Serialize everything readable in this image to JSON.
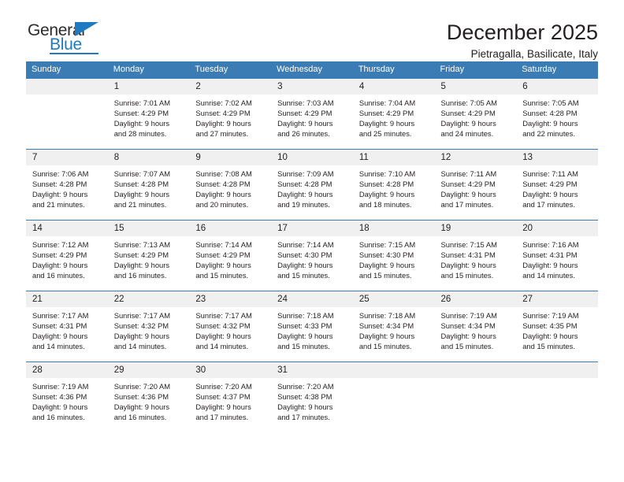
{
  "brand": {
    "name_top": "General",
    "name_bottom": "Blue",
    "accent_color": "#1f7ac0",
    "triangle_icon": "triangle-icon"
  },
  "header": {
    "title": "December 2025",
    "subtitle": "Pietragalla, Basilicate, Italy"
  },
  "theme": {
    "header_row_bg": "#3b7cb5",
    "daynum_bg": "#f0f0f0",
    "text_color": "#231f20"
  },
  "weekday_headers": [
    "Sunday",
    "Monday",
    "Tuesday",
    "Wednesday",
    "Thursday",
    "Friday",
    "Saturday"
  ],
  "labels": {
    "sunrise_prefix": "Sunrise:",
    "sunset_prefix": "Sunset:",
    "daylight_prefix": "Daylight:"
  },
  "weeks": [
    [
      {
        "day": "",
        "lines": []
      },
      {
        "day": "1",
        "lines": [
          "Sunrise: 7:01 AM",
          "Sunset: 4:29 PM",
          "Daylight: 9 hours",
          "and 28 minutes."
        ]
      },
      {
        "day": "2",
        "lines": [
          "Sunrise: 7:02 AM",
          "Sunset: 4:29 PM",
          "Daylight: 9 hours",
          "and 27 minutes."
        ]
      },
      {
        "day": "3",
        "lines": [
          "Sunrise: 7:03 AM",
          "Sunset: 4:29 PM",
          "Daylight: 9 hours",
          "and 26 minutes."
        ]
      },
      {
        "day": "4",
        "lines": [
          "Sunrise: 7:04 AM",
          "Sunset: 4:29 PM",
          "Daylight: 9 hours",
          "and 25 minutes."
        ]
      },
      {
        "day": "5",
        "lines": [
          "Sunrise: 7:05 AM",
          "Sunset: 4:29 PM",
          "Daylight: 9 hours",
          "and 24 minutes."
        ]
      },
      {
        "day": "6",
        "lines": [
          "Sunrise: 7:05 AM",
          "Sunset: 4:28 PM",
          "Daylight: 9 hours",
          "and 22 minutes."
        ]
      }
    ],
    [
      {
        "day": "7",
        "lines": [
          "Sunrise: 7:06 AM",
          "Sunset: 4:28 PM",
          "Daylight: 9 hours",
          "and 21 minutes."
        ]
      },
      {
        "day": "8",
        "lines": [
          "Sunrise: 7:07 AM",
          "Sunset: 4:28 PM",
          "Daylight: 9 hours",
          "and 21 minutes."
        ]
      },
      {
        "day": "9",
        "lines": [
          "Sunrise: 7:08 AM",
          "Sunset: 4:28 PM",
          "Daylight: 9 hours",
          "and 20 minutes."
        ]
      },
      {
        "day": "10",
        "lines": [
          "Sunrise: 7:09 AM",
          "Sunset: 4:28 PM",
          "Daylight: 9 hours",
          "and 19 minutes."
        ]
      },
      {
        "day": "11",
        "lines": [
          "Sunrise: 7:10 AM",
          "Sunset: 4:28 PM",
          "Daylight: 9 hours",
          "and 18 minutes."
        ]
      },
      {
        "day": "12",
        "lines": [
          "Sunrise: 7:11 AM",
          "Sunset: 4:29 PM",
          "Daylight: 9 hours",
          "and 17 minutes."
        ]
      },
      {
        "day": "13",
        "lines": [
          "Sunrise: 7:11 AM",
          "Sunset: 4:29 PM",
          "Daylight: 9 hours",
          "and 17 minutes."
        ]
      }
    ],
    [
      {
        "day": "14",
        "lines": [
          "Sunrise: 7:12 AM",
          "Sunset: 4:29 PM",
          "Daylight: 9 hours",
          "and 16 minutes."
        ]
      },
      {
        "day": "15",
        "lines": [
          "Sunrise: 7:13 AM",
          "Sunset: 4:29 PM",
          "Daylight: 9 hours",
          "and 16 minutes."
        ]
      },
      {
        "day": "16",
        "lines": [
          "Sunrise: 7:14 AM",
          "Sunset: 4:29 PM",
          "Daylight: 9 hours",
          "and 15 minutes."
        ]
      },
      {
        "day": "17",
        "lines": [
          "Sunrise: 7:14 AM",
          "Sunset: 4:30 PM",
          "Daylight: 9 hours",
          "and 15 minutes."
        ]
      },
      {
        "day": "18",
        "lines": [
          "Sunrise: 7:15 AM",
          "Sunset: 4:30 PM",
          "Daylight: 9 hours",
          "and 15 minutes."
        ]
      },
      {
        "day": "19",
        "lines": [
          "Sunrise: 7:15 AM",
          "Sunset: 4:31 PM",
          "Daylight: 9 hours",
          "and 15 minutes."
        ]
      },
      {
        "day": "20",
        "lines": [
          "Sunrise: 7:16 AM",
          "Sunset: 4:31 PM",
          "Daylight: 9 hours",
          "and 14 minutes."
        ]
      }
    ],
    [
      {
        "day": "21",
        "lines": [
          "Sunrise: 7:17 AM",
          "Sunset: 4:31 PM",
          "Daylight: 9 hours",
          "and 14 minutes."
        ]
      },
      {
        "day": "22",
        "lines": [
          "Sunrise: 7:17 AM",
          "Sunset: 4:32 PM",
          "Daylight: 9 hours",
          "and 14 minutes."
        ]
      },
      {
        "day": "23",
        "lines": [
          "Sunrise: 7:17 AM",
          "Sunset: 4:32 PM",
          "Daylight: 9 hours",
          "and 14 minutes."
        ]
      },
      {
        "day": "24",
        "lines": [
          "Sunrise: 7:18 AM",
          "Sunset: 4:33 PM",
          "Daylight: 9 hours",
          "and 15 minutes."
        ]
      },
      {
        "day": "25",
        "lines": [
          "Sunrise: 7:18 AM",
          "Sunset: 4:34 PM",
          "Daylight: 9 hours",
          "and 15 minutes."
        ]
      },
      {
        "day": "26",
        "lines": [
          "Sunrise: 7:19 AM",
          "Sunset: 4:34 PM",
          "Daylight: 9 hours",
          "and 15 minutes."
        ]
      },
      {
        "day": "27",
        "lines": [
          "Sunrise: 7:19 AM",
          "Sunset: 4:35 PM",
          "Daylight: 9 hours",
          "and 15 minutes."
        ]
      }
    ],
    [
      {
        "day": "28",
        "lines": [
          "Sunrise: 7:19 AM",
          "Sunset: 4:36 PM",
          "Daylight: 9 hours",
          "and 16 minutes."
        ]
      },
      {
        "day": "29",
        "lines": [
          "Sunrise: 7:20 AM",
          "Sunset: 4:36 PM",
          "Daylight: 9 hours",
          "and 16 minutes."
        ]
      },
      {
        "day": "30",
        "lines": [
          "Sunrise: 7:20 AM",
          "Sunset: 4:37 PM",
          "Daylight: 9 hours",
          "and 17 minutes."
        ]
      },
      {
        "day": "31",
        "lines": [
          "Sunrise: 7:20 AM",
          "Sunset: 4:38 PM",
          "Daylight: 9 hours",
          "and 17 minutes."
        ]
      },
      {
        "day": "",
        "lines": []
      },
      {
        "day": "",
        "lines": []
      },
      {
        "day": "",
        "lines": []
      }
    ]
  ]
}
